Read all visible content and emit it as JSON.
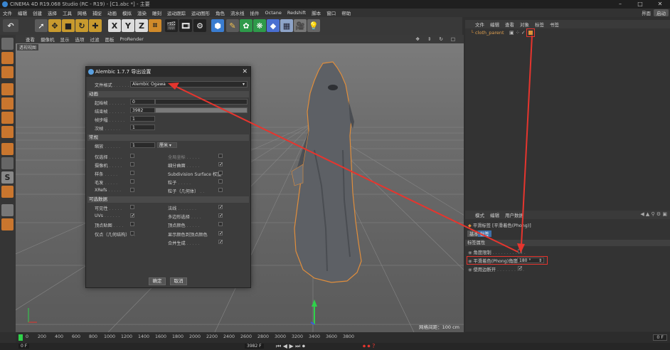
{
  "window": {
    "title": "CINEMA 4D R19.068 Studio (RC - R19) - [C1.abc *] - 主要",
    "layout_label": "界面",
    "layout_value": "启动"
  },
  "menubar": [
    "文件",
    "编辑",
    "创建",
    "选择",
    "工具",
    "网格",
    "捕捉",
    "动画",
    "模拟",
    "渲染",
    "雕刻",
    "运动跟踪",
    "运动图形",
    "角色",
    "流水线",
    "插件",
    "Octane",
    "Redshift",
    "脚本",
    "窗口",
    "帮助"
  ],
  "viewport": {
    "menu": [
      "查看",
      "摄像机",
      "显示",
      "选项",
      "过滤",
      "面板",
      "ProRender"
    ],
    "label": "透视视图",
    "status": "网格间距：100 cm"
  },
  "dialog": {
    "title": "Alembic 1.7.7 导出设置",
    "close": "✕",
    "format_label": "文件格式",
    "format_value": "Alembic Ogawa",
    "sections": {
      "animation": "动画",
      "general": "常规",
      "visibility": "可选数据"
    },
    "fields": {
      "start_label": "起始帧",
      "start_value": "0",
      "end_label": "结束帧",
      "end_value": "3982",
      "step_label": "帧步幅",
      "step_value": "1",
      "sub_label": "次帧",
      "sub_value": "1",
      "scale_label": "缩放",
      "scale_value": "1",
      "scale_unit": "厘米"
    },
    "options_left": [
      "仅选择",
      "摄像机",
      "样条",
      "毛发",
      "XRefs"
    ],
    "options_right": [
      "全局坐标",
      "细分曲面",
      "Subdivision Surface 权重",
      "粒子",
      "粒子（几何体）"
    ],
    "options_right_checked": [
      false,
      true,
      false,
      false,
      false
    ],
    "optional_left": [
      "可见性",
      "UVs",
      "顶点贴图"
    ],
    "optional_left_checked": [
      false,
      true,
      false
    ],
    "optional_right": [
      "法线",
      "多边形选择",
      "顶点颜色"
    ],
    "optional_right_checked": [
      true,
      true,
      false
    ],
    "extra_left": "仅点（几何结构）",
    "extra_right": [
      "显示颜色到顶点颜色",
      "合并生成"
    ],
    "extra_right_checked": [
      true,
      true
    ],
    "ok": "确定",
    "cancel": "取消"
  },
  "object_manager": {
    "menu": [
      "文件",
      "编辑",
      "查看",
      "对象",
      "标签",
      "书签"
    ],
    "object_name": "cloth_parent"
  },
  "attribute_manager": {
    "menu": [
      "模式",
      "编辑",
      "用户数据"
    ],
    "tag_title": "平滑标签 [平滑着色(Phong)]",
    "tabs": [
      "基本",
      "标签"
    ],
    "section": "标签属性",
    "angle_limit_label": "角度限制",
    "phong_angle_label": "平滑着色(Phong)角度",
    "phong_angle_value": "180 °",
    "use_edge_label": "使用边断开"
  },
  "timeline": {
    "ticks": [
      "0",
      "200",
      "400",
      "600",
      "800",
      "1000",
      "1200",
      "1400",
      "1600",
      "1800",
      "2000",
      "2200",
      "2400",
      "2600",
      "2800",
      "3000",
      "3200",
      "3400",
      "3600",
      "3800"
    ],
    "frame": "0 F",
    "start": "0 F",
    "end": "3982 F"
  },
  "colors": {
    "accent": "#e6352e",
    "orange": "#e0913a",
    "green": "#2fd24a"
  }
}
